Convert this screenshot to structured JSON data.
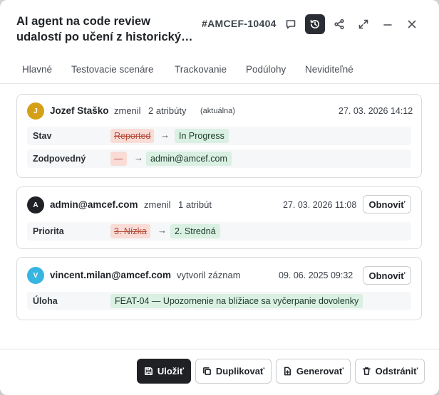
{
  "modal": {
    "title_line1": "AI agent na code review",
    "title_line2": "udalostí po učení z historický…",
    "ticket_id": "#AMCEF-10404"
  },
  "tabs": [
    {
      "label": "Hlavné"
    },
    {
      "label": "Testovacie scenáre"
    },
    {
      "label": "Trackovanie"
    },
    {
      "label": "Podúlohy"
    },
    {
      "label": "Neviditeľné"
    }
  ],
  "history": [
    {
      "avatar_letter": "J",
      "avatar_color": "#d4a017",
      "author": "Jozef Staško",
      "action": "zmenil",
      "count": "2 atribúty",
      "current_label": "(aktuálna)",
      "timestamp": "27. 03. 2026 14:12",
      "changes": [
        {
          "field": "Stav",
          "old": "Reported",
          "new": "In Progress"
        },
        {
          "field": "Zodpovedný",
          "old": "—",
          "new": "admin@amcef.com"
        }
      ]
    },
    {
      "avatar_letter": "A",
      "avatar_color": "#1f2125",
      "author": "admin@amcef.com",
      "action": "zmenil",
      "count": "1 atribút",
      "timestamp": "27. 03. 2026 11:08",
      "restore_label": "Obnoviť",
      "changes": [
        {
          "field": "Priorita",
          "old": "3. Nízka",
          "new": "2. Stredná"
        }
      ]
    },
    {
      "avatar_letter": "V",
      "avatar_color": "#36b5e0",
      "author": "vincent.milan@amcef.com",
      "action": "vytvoril záznam",
      "timestamp": "09. 06. 2025 09:32",
      "restore_label": "Obnoviť",
      "changes": [
        {
          "field": "Úloha",
          "new": "FEAT-04 — Upozornenie na blížiace sa vyčerpanie dovolenky"
        }
      ]
    }
  ],
  "footer": {
    "save": "Uložiť",
    "duplicate": "Duplikovať",
    "generate": "Generovať",
    "delete": "Odstrániť"
  },
  "icons": {
    "comment": "comment-icon",
    "history": "history-icon",
    "share": "share-icon",
    "expand": "expand-icon",
    "minimize": "minimize-icon",
    "close": "close-icon"
  },
  "colors": {
    "primary_button": "#1f2125",
    "old_value_bg": "#f9dcd6",
    "new_value_bg": "#d9f0e2"
  }
}
